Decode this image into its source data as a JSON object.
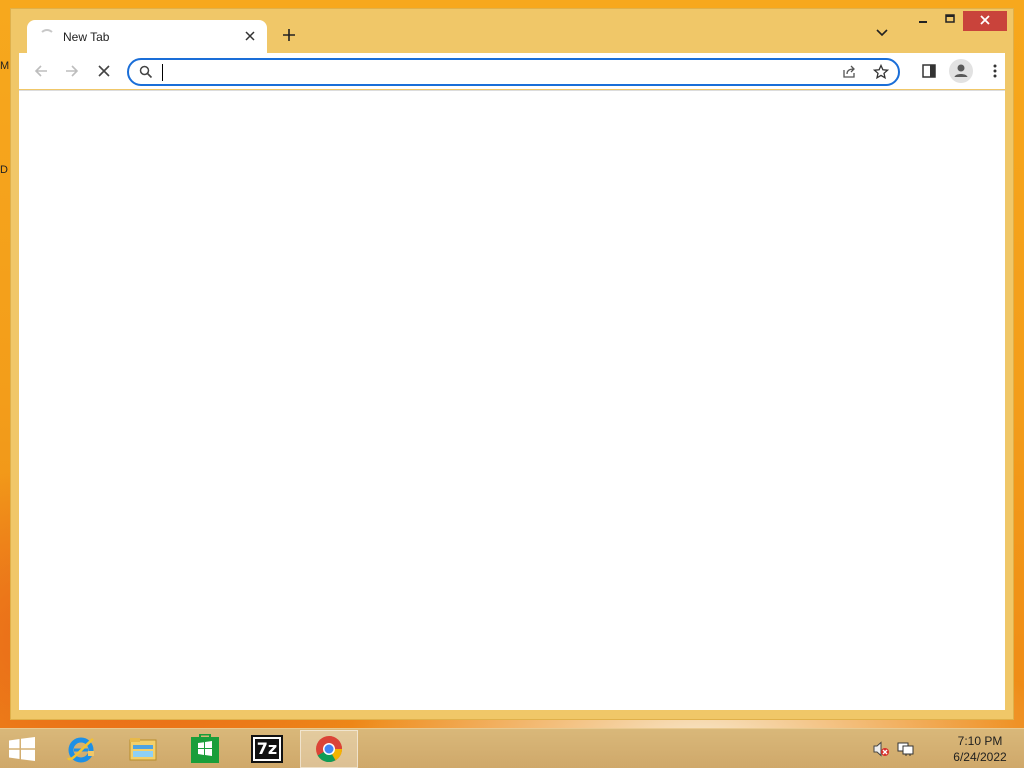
{
  "desktop": {
    "labels": [
      "M",
      "D"
    ]
  },
  "browser": {
    "tab": {
      "title": "New Tab",
      "close_icon": "close-icon"
    },
    "new_tab_icon": "plus-icon",
    "tab_search_icon": "chevron-down-icon",
    "window_controls": {
      "minimize_icon": "minimize-icon",
      "maximize_icon": "maximize-icon",
      "close_icon": "close-icon"
    },
    "toolbar": {
      "back_icon": "arrow-left-icon",
      "forward_icon": "arrow-right-icon",
      "stop_icon": "close-icon",
      "omnibox": {
        "value": "",
        "search_icon": "search-icon",
        "share_icon": "share-icon",
        "bookmark_icon": "star-icon"
      },
      "side_panel_icon": "side-panel-icon",
      "profile_icon": "person-icon",
      "menu_icon": "kebab-menu-icon"
    },
    "accent_color": "#1a6ed8",
    "frame_color": "#f0c768"
  },
  "taskbar": {
    "apps": [
      {
        "name": "Internet Explorer",
        "icon": "internet-explorer-icon"
      },
      {
        "name": "File Explorer",
        "icon": "folder-icon"
      },
      {
        "name": "Store",
        "icon": "store-icon"
      },
      {
        "name": "7-Zip",
        "icon": "7zip-icon",
        "label": "7z"
      },
      {
        "name": "Google Chrome",
        "icon": "chrome-icon",
        "active": true
      }
    ],
    "tray": {
      "volume_icon": "volume-muted-icon",
      "network_icon": "network-icon"
    },
    "clock": {
      "time": "7:10 PM",
      "date": "6/24/2022"
    }
  }
}
